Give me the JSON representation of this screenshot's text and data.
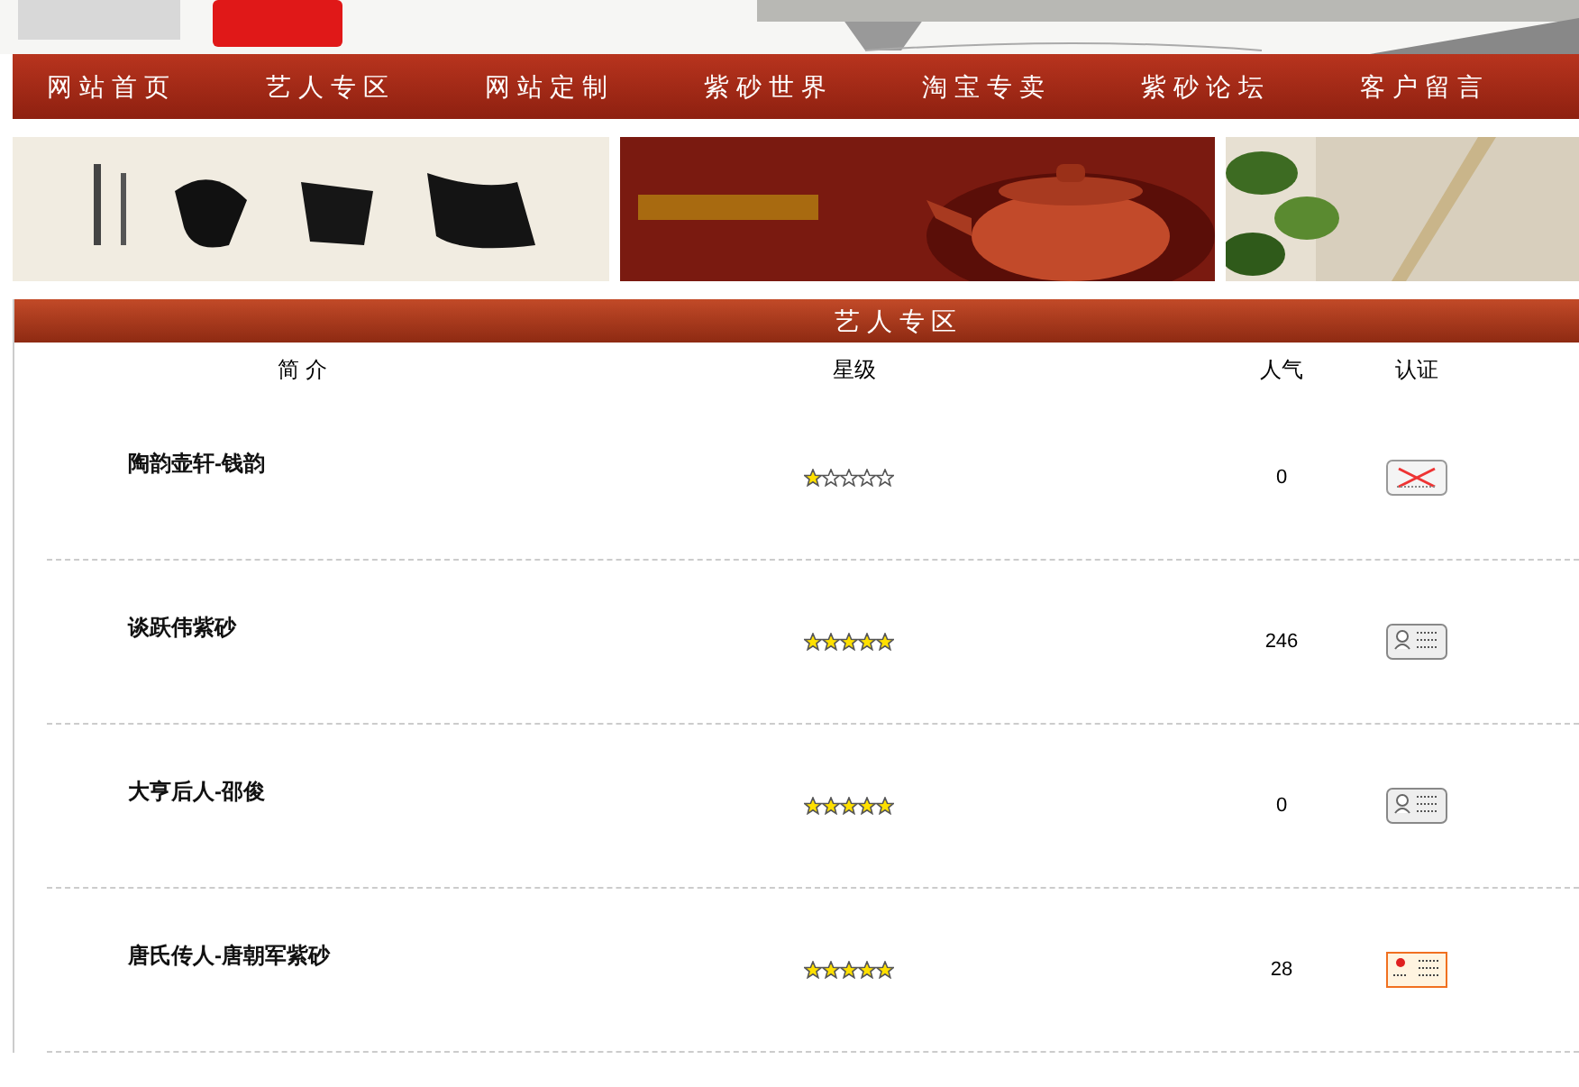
{
  "nav": [
    "网站首页",
    "艺人专区",
    "网站定制",
    "紫砂世界",
    "淘宝专卖",
    "紫砂论坛",
    "客户留言"
  ],
  "section": {
    "title": "艺 人 专 区"
  },
  "table": {
    "columns": [
      "简 介",
      "星级",
      "人气",
      "认证"
    ],
    "rows": [
      {
        "name": "陶韵壶轩-钱韵",
        "stars": 1,
        "views": "0",
        "kind": "none"
      },
      {
        "name": "谈跃伟紫砂",
        "stars": 5,
        "views": "246",
        "kind": "grey"
      },
      {
        "name": "大亨后人-邵俊",
        "stars": 5,
        "views": "0",
        "kind": "grey"
      },
      {
        "name": "唐氏传人-唐朝军紫砂",
        "stars": 5,
        "views": "28",
        "kind": "verified"
      }
    ]
  }
}
